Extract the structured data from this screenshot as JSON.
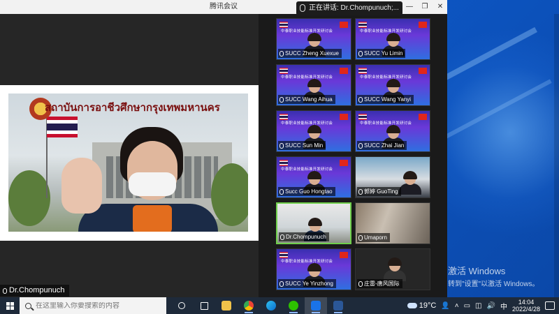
{
  "window": {
    "title": "腾讯会议",
    "controls": [
      "—",
      "❐",
      "✕"
    ]
  },
  "speaking": {
    "text": "正在讲话: Dr.Chompunuch;..."
  },
  "main": {
    "banner_text": "สถาบันการอาชีวศึกษากรุงเทพมหานคร",
    "speaker_name": "Dr.Chompunuch"
  },
  "tiles": [
    {
      "name": "SUCC Zheng Xuexue",
      "style": "purple"
    },
    {
      "name": "SUCC Yu Limin",
      "style": "purple"
    },
    {
      "name": "SUCC Wang Aihua",
      "style": "purple"
    },
    {
      "name": "SUCC Wang Yanyi",
      "style": "purple"
    },
    {
      "name": "SUCC Sun Min",
      "style": "purple"
    },
    {
      "name": "SUCC Zhai Jian",
      "style": "purple"
    },
    {
      "name": "Succ Guo Hongtao",
      "style": "purple"
    },
    {
      "name": "郭婷 GuoTing",
      "style": "cam-blue"
    },
    {
      "name": "Dr.Chompunuch",
      "style": "cam-shared"
    },
    {
      "name": "Umaporn",
      "style": "cam-room"
    },
    {
      "name": "SUCC Ye Yinzhong",
      "style": "purple"
    },
    {
      "name": "庄雷-唐风国际",
      "style": "cam-dark"
    }
  ],
  "tile_heading": "中泰职业技能标准开发研讨会",
  "desktop": {
    "activate_title": "激活 Windows",
    "activate_sub": "转到\"设置\"以激活 Windows。"
  },
  "taskbar": {
    "search_placeholder": "在这里输入你要搜索的内容",
    "weather": "19°C",
    "ime": "中",
    "time": "14:04",
    "date": "2022/4/28"
  },
  "colors": {
    "active_border": "#6fcf4b",
    "taskbar": "#1e2a3a",
    "tile_purple": "#4a33c4"
  }
}
